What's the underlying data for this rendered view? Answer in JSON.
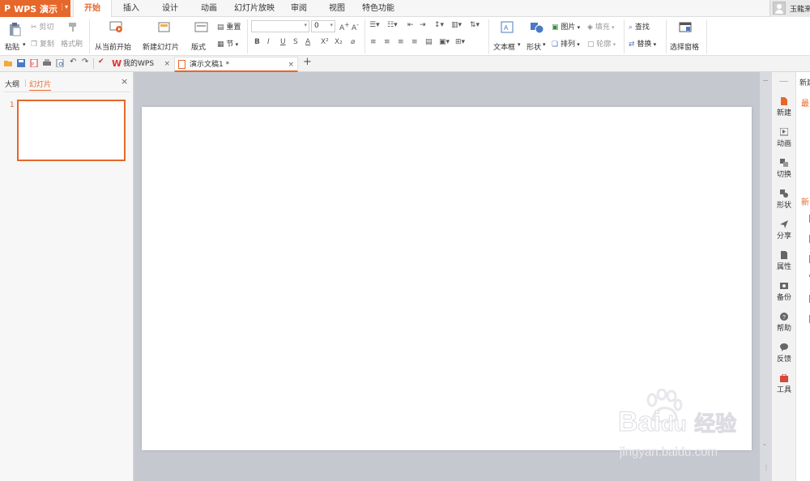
{
  "app": {
    "brand": "WPS 演示",
    "brand_prefix": "P",
    "accent": "#e6672a"
  },
  "menu": {
    "tabs": [
      "开始",
      "插入",
      "设计",
      "动画",
      "幻灯片放映",
      "审阅",
      "视图",
      "特色功能"
    ],
    "active": "开始"
  },
  "user": {
    "name": "玉龍来"
  },
  "ribbon": {
    "paste": "粘贴",
    "cut": "剪切",
    "copy": "复制",
    "format_painter": "格式刷",
    "from_current": "从当前开始",
    "new_slide": "新建幻灯片",
    "layout": "版式",
    "reset": "重置",
    "section": "节",
    "font_size": "0",
    "text_box": "文本框",
    "shape": "形状",
    "picture": "图片",
    "fill": "填充",
    "arrange": "排列",
    "outline": "轮廓",
    "find": "查找",
    "replace": "替换",
    "selection_pane": "选择窗格",
    "bold": "B",
    "italic": "I",
    "underline": "U",
    "strike": "S",
    "font_color": "A",
    "superscript": "X²",
    "subscript": "X₂"
  },
  "doc_tabs": [
    {
      "label": "我的WPS",
      "close": "×"
    },
    {
      "label": "演示文稿1 *",
      "close": "×"
    }
  ],
  "new_tab": "+",
  "left_panel": {
    "outline": "大纲",
    "slides": "幻灯片",
    "close": "×",
    "slide_number": "1"
  },
  "right_tools": [
    "新建",
    "动画",
    "切换",
    "形状",
    "分享",
    "属性",
    "备份",
    "帮助",
    "反馈",
    "工具"
  ],
  "right_dock": {
    "title": "新建",
    "recent": "最",
    "new_section": "新"
  },
  "watermark": {
    "brand": "Bai",
    "brand2": "du",
    "product": "经验",
    "url": "jingyan.baidu.com"
  }
}
